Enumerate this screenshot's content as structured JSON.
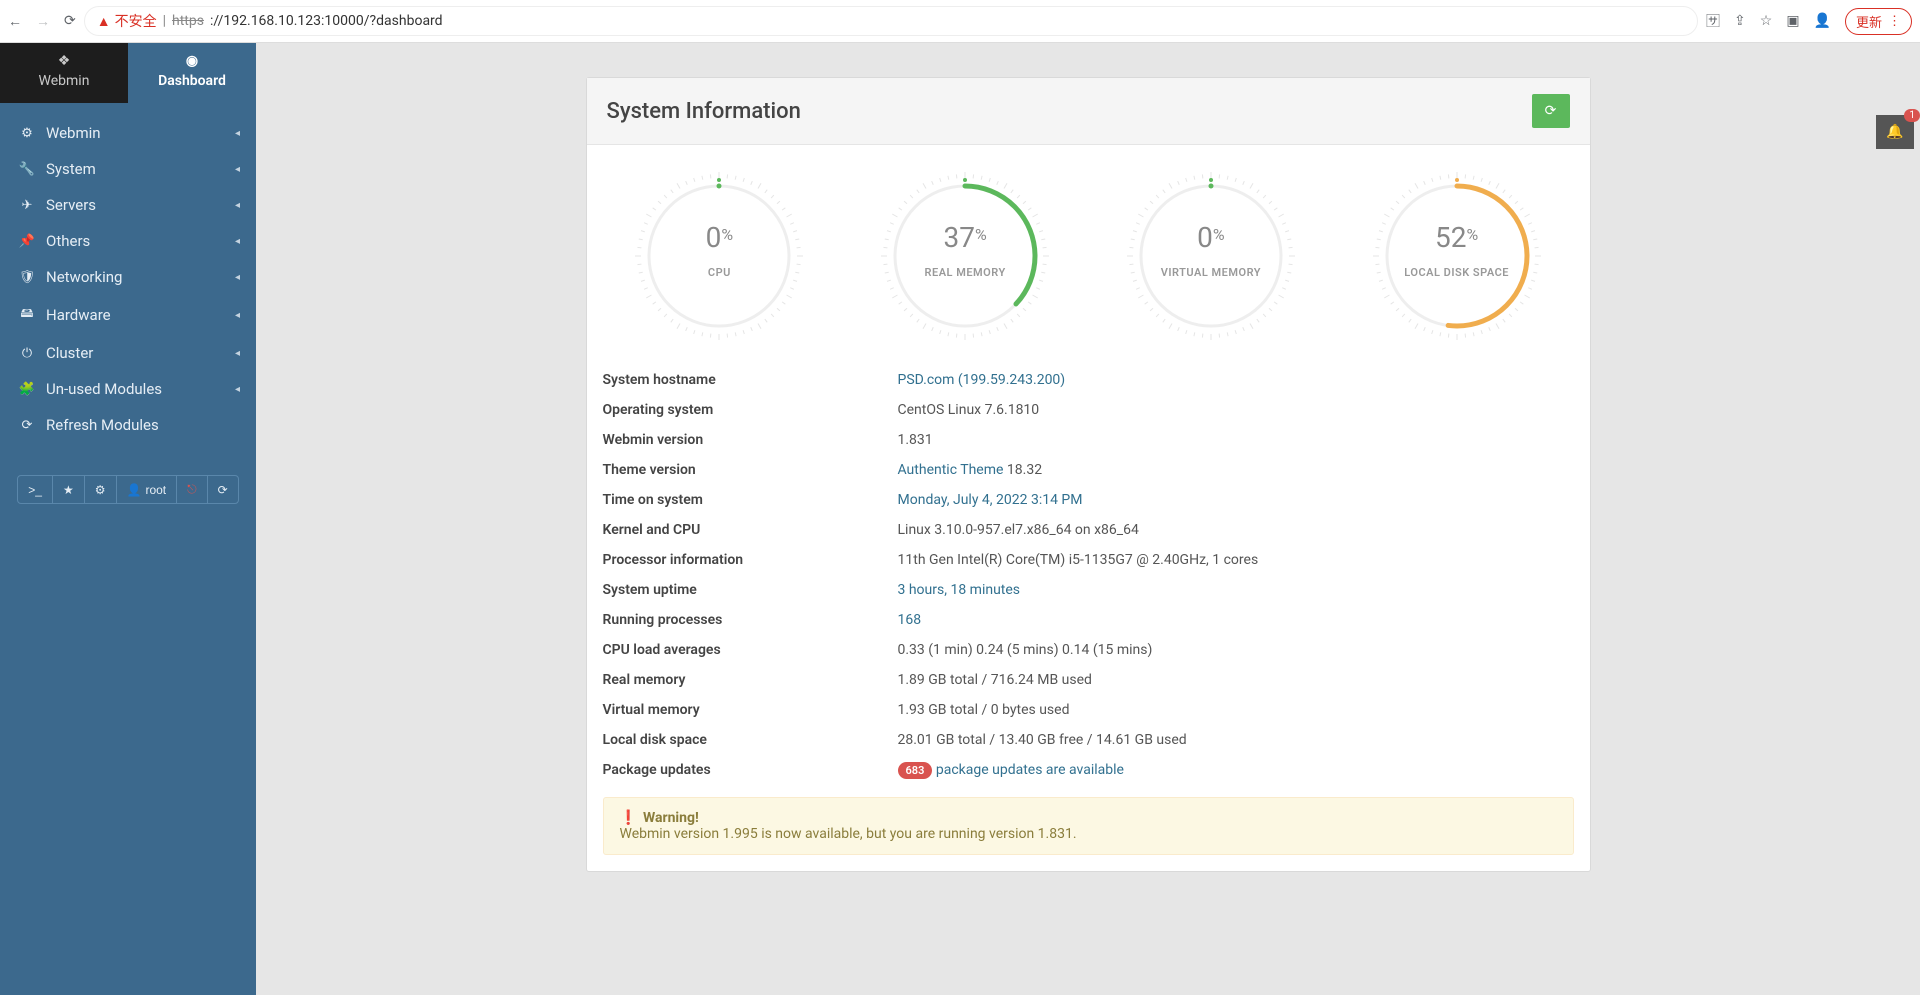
{
  "browser": {
    "insecure": "不安全",
    "https": "https",
    "url": "://192.168.10.123:10000/?dashboard",
    "update": "更新"
  },
  "sidebar": {
    "tab_webmin": "Webmin",
    "tab_dashboard": "Dashboard",
    "items": [
      {
        "icon": "gear-icon",
        "label": "Webmin",
        "caret": true
      },
      {
        "icon": "wrench-icon",
        "label": "System",
        "caret": true
      },
      {
        "icon": "server-icon",
        "label": "Servers",
        "caret": true
      },
      {
        "icon": "pin-icon",
        "label": "Others",
        "caret": true
      },
      {
        "icon": "shield-icon",
        "label": "Networking",
        "caret": true
      },
      {
        "icon": "hdd-icon",
        "label": "Hardware",
        "caret": true
      },
      {
        "icon": "power-icon",
        "label": "Cluster",
        "caret": true
      },
      {
        "icon": "puzzle-icon",
        "label": "Un-used Modules",
        "caret": true
      },
      {
        "icon": "refresh-icon",
        "label": "Refresh Modules",
        "caret": false
      }
    ],
    "toolbar_user": "root"
  },
  "title": "System Information",
  "gauges": [
    {
      "value": 0,
      "label": "CPU",
      "color": "#5cb85c"
    },
    {
      "value": 37,
      "label": "REAL MEMORY",
      "color": "#5cb85c"
    },
    {
      "value": 0,
      "label": "VIRTUAL MEMORY",
      "color": "#5cb85c"
    },
    {
      "value": 52,
      "label": "LOCAL DISK SPACE",
      "color": "#f0ad4e"
    }
  ],
  "info": [
    {
      "k": "System hostname",
      "v": "PSD.com (199.59.243.200)",
      "link": true
    },
    {
      "k": "Operating system",
      "v": "CentOS Linux 7.6.1810"
    },
    {
      "k": "Webmin version",
      "v": "1.831"
    },
    {
      "k": "Theme version",
      "pre": "Authentic Theme",
      "post": " 18.32",
      "link": true
    },
    {
      "k": "Time on system",
      "v": "Monday, July 4, 2022 3:14 PM",
      "link": true
    },
    {
      "k": "Kernel and CPU",
      "v": "Linux 3.10.0-957.el7.x86_64 on x86_64"
    },
    {
      "k": "Processor information",
      "v": "11th Gen Intel(R) Core(TM) i5-1135G7 @ 2.40GHz, 1 cores"
    },
    {
      "k": "System uptime",
      "v": "3 hours, 18 minutes",
      "link": true
    },
    {
      "k": "Running processes",
      "v": "168",
      "link": true
    },
    {
      "k": "CPU load averages",
      "v": "0.33 (1 min) 0.24 (5 mins) 0.14 (15 mins)"
    },
    {
      "k": "Real memory",
      "v": "1.89 GB total / 716.24 MB used"
    },
    {
      "k": "Virtual memory",
      "v": "1.93 GB total / 0 bytes used"
    },
    {
      "k": "Local disk space",
      "v": "28.01 GB total / 13.40 GB free / 14.61 GB used"
    },
    {
      "k": "Package updates",
      "badge": "683",
      "v": "package updates are available",
      "link": true
    }
  ],
  "warning": {
    "title": "Warning!",
    "body": "Webmin version 1.995 is now available, but you are running version 1.831."
  },
  "notifications": {
    "count": "1"
  },
  "chart_data": {
    "type": "bar",
    "categories": [
      "CPU",
      "REAL MEMORY",
      "VIRTUAL MEMORY",
      "LOCAL DISK SPACE"
    ],
    "values": [
      0,
      37,
      0,
      52
    ],
    "ylim": [
      0,
      100
    ],
    "ylabel": "percent"
  }
}
